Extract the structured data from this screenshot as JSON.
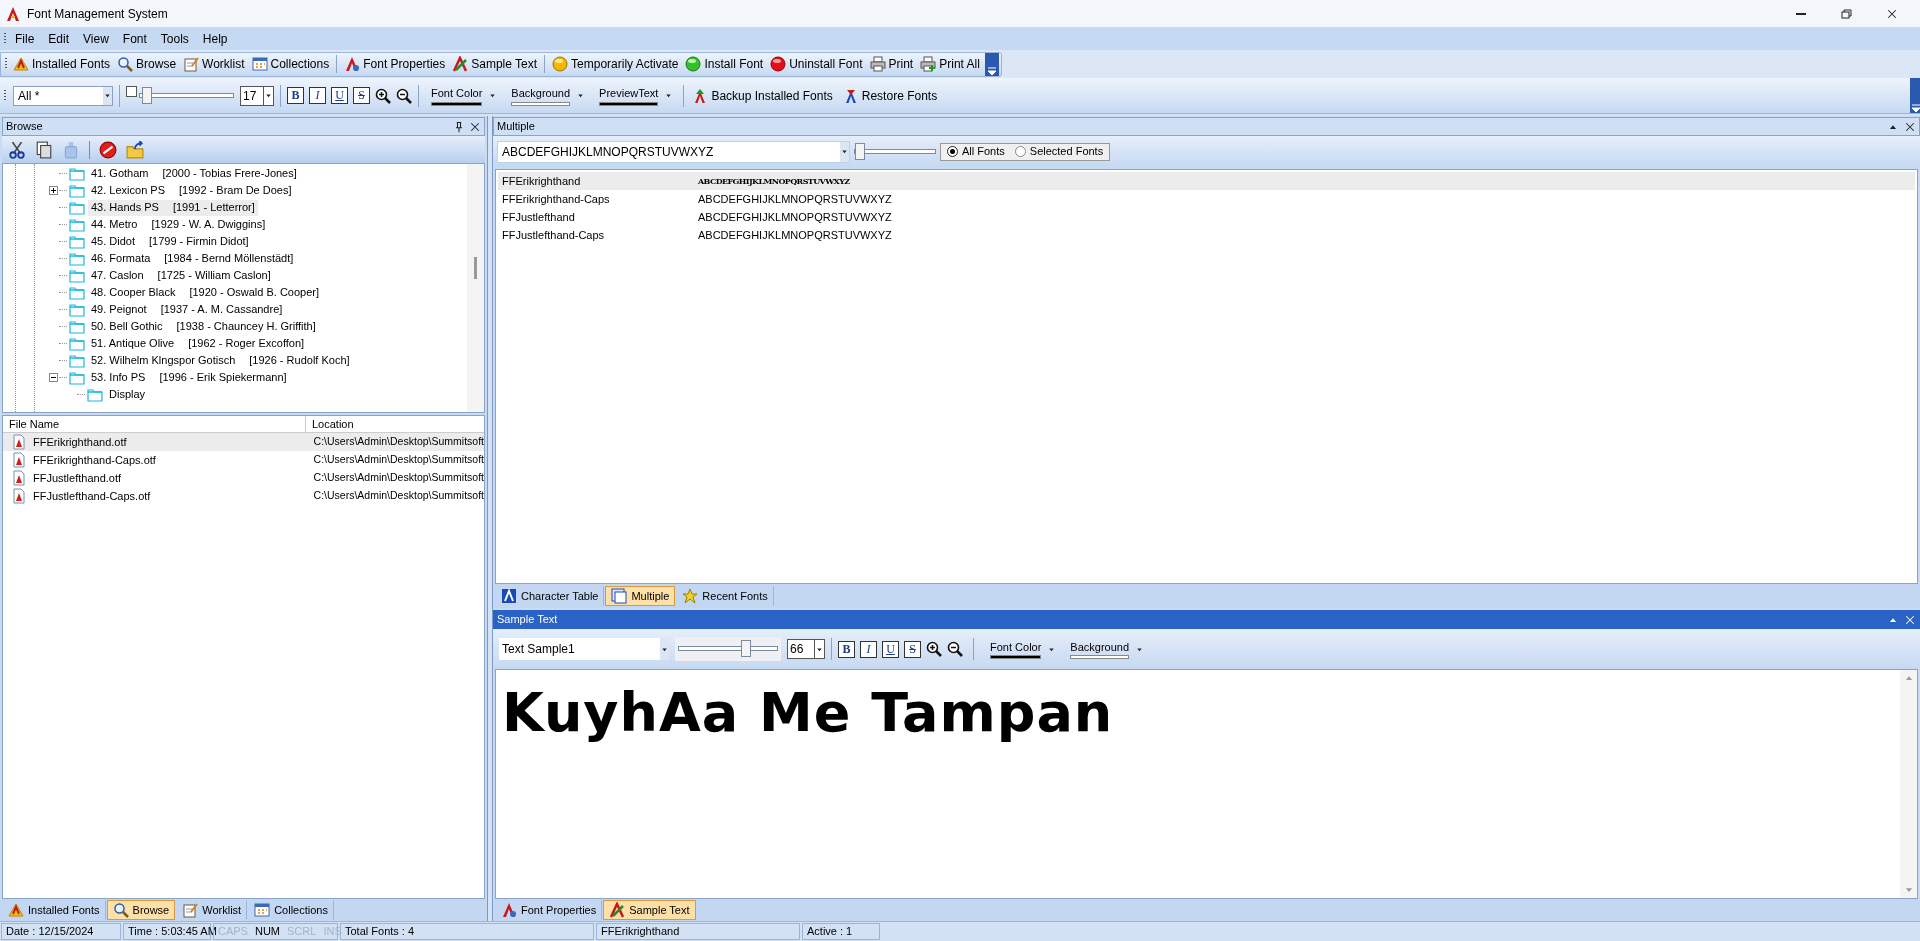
{
  "window": {
    "title": "Font Management System"
  },
  "menu": [
    "File",
    "Edit",
    "View",
    "Font",
    "Tools",
    "Help"
  ],
  "main_toolbar": [
    [
      "Installed Fonts",
      "Browse",
      "Worklist",
      "Collections"
    ],
    [
      "Font Properties",
      "Sample Text"
    ],
    [
      "Temporarily Activate",
      "Install Font",
      "Uninstall Font",
      "Print",
      "Print All"
    ]
  ],
  "format_toolbar": {
    "filter": "All *",
    "slider_checked": false,
    "slider": {
      "level": 0.03
    },
    "size": "17",
    "styles": [
      "B",
      "I",
      "U",
      "S"
    ],
    "color_buttons": [
      {
        "label": "Font Color",
        "color": "#000000"
      },
      {
        "label": "Background",
        "color": "#ffffff"
      },
      {
        "label": "PreviewText",
        "color": "#000000"
      }
    ],
    "actions": [
      "Backup Installed Fonts",
      "Restore Fonts"
    ]
  },
  "browse_panel": {
    "title": "Browse",
    "tree": [
      {
        "label": "41. Gotham",
        "detail": "[2000 - Tobias Frere-Jones]",
        "selected": false
      },
      {
        "label": "42. Lexicon PS",
        "detail": "[1992 - Bram De Does]",
        "selected": false,
        "expanded": false
      },
      {
        "label": "43. Hands PS",
        "detail": "[1991 - Letterror]",
        "selected": true
      },
      {
        "label": "44. Metro",
        "detail": "[1929 - W. A. Dwiggins]",
        "selected": false
      },
      {
        "label": "45. Didot",
        "detail": "[1799 - Firmin Didot]",
        "selected": false
      },
      {
        "label": "46. Formata",
        "detail": "[1984 - Bernd Möllenstädt]",
        "selected": false
      },
      {
        "label": "47. Caslon",
        "detail": "[1725 - William Caslon]",
        "selected": false
      },
      {
        "label": "48. Cooper Black",
        "detail": "[1920 - Oswald B. Cooper]",
        "selected": false
      },
      {
        "label": "49. Peignot",
        "detail": "[1937 - A. M. Cassandre]",
        "selected": false
      },
      {
        "label": "50. Bell Gothic",
        "detail": "[1938 - Chauncey H. Griffith]",
        "selected": false
      },
      {
        "label": "51. Antique Olive",
        "detail": "[1962 - Roger Excoffon]",
        "selected": false
      },
      {
        "label": "52. Wilhelm Klngspor Gotisch",
        "detail": "[1926 - Rudolf Koch]",
        "selected": false
      },
      {
        "label": "53. Info PS",
        "detail": "[1996 - Erik Spiekermann]",
        "selected": false,
        "expanded": true,
        "children": [
          {
            "label": "Display",
            "selected": false
          }
        ]
      }
    ]
  },
  "file_list": {
    "columns": [
      "File Name",
      "Location"
    ],
    "rows": [
      {
        "name": "FFErikrighthand.otf",
        "location": "C:\\Users\\Admin\\Desktop\\Summitsoft",
        "selected": true
      },
      {
        "name": "FFErikrighthand-Caps.otf",
        "location": "C:\\Users\\Admin\\Desktop\\Summitsoft",
        "selected": false
      },
      {
        "name": "FFJustlefthand.otf",
        "location": "C:\\Users\\Admin\\Desktop\\Summitsoft",
        "selected": false
      },
      {
        "name": "FFJustlefthand-Caps.otf",
        "location": "C:\\Users\\Admin\\Desktop\\Summitsoft",
        "selected": false
      }
    ]
  },
  "left_tabs": [
    {
      "label": "Installed Fonts",
      "selected": false
    },
    {
      "label": "Browse",
      "selected": true
    },
    {
      "label": "Worklist",
      "selected": false
    },
    {
      "label": "Collections",
      "selected": false
    }
  ],
  "multiple_panel": {
    "title": "Multiple",
    "preview_text": "ABCDEFGHIJKLMNOPQRSTUVWXYZ",
    "slider": {
      "level": 0.02
    },
    "scope": [
      {
        "label": "All Fonts",
        "selected": true
      },
      {
        "label": "Selected Fonts",
        "selected": false
      }
    ],
    "rows": [
      {
        "name": "FFErikrighthand",
        "sample": "ABCDEFGHIJKLMNOPQRSTUVWXYZ",
        "selected": true,
        "kind": "script"
      },
      {
        "name": "FFErikrighthand-Caps",
        "sample": "ABCDEFGHIJKLMNOPQRSTUVWXYZ",
        "selected": false,
        "kind": "plain"
      },
      {
        "name": "FFJustlefthand",
        "sample": "ABCDEFGHIJKLMNOPQRSTUVWXYZ",
        "selected": false,
        "kind": "plain"
      },
      {
        "name": "FFJustlefthand-Caps",
        "sample": "ABCDEFGHIJKLMNOPQRSTUVWXYZ",
        "selected": false,
        "kind": "plain"
      }
    ]
  },
  "middle_tabs": [
    {
      "label": "Character Table",
      "selected": false
    },
    {
      "label": "Multiple",
      "selected": true
    },
    {
      "label": "Recent Fonts",
      "selected": false
    }
  ],
  "sample_panel": {
    "title": "Sample Text",
    "text_choice": "Text Sample1",
    "slider": {
      "level": 0.7
    },
    "size": "66",
    "styles": [
      "B",
      "I",
      "U",
      "S"
    ],
    "color_buttons": [
      {
        "label": "Font Color",
        "color": "#000000"
      },
      {
        "label": "Background",
        "color": "#ffffff"
      }
    ],
    "preview": "KuyhAa Me Tampan"
  },
  "right_tabs": [
    {
      "label": "Font Properties",
      "selected": false
    },
    {
      "label": "Sample Text",
      "selected": true
    }
  ],
  "status_bar": [
    {
      "text": "Date : 12/15/2024",
      "enabled": true
    },
    {
      "text": "Time : 5:03:45 AM",
      "enabled": true
    },
    {
      "text": "CAPS",
      "enabled": false
    },
    {
      "text": "NUM",
      "enabled": true
    },
    {
      "text": "SCRL",
      "enabled": false
    },
    {
      "text": "INS",
      "enabled": false
    },
    {
      "text": "Total Fonts : 4",
      "enabled": true
    },
    {
      "text": "FFErikrighthand",
      "enabled": true
    },
    {
      "text": "Active : 1",
      "enabled": true
    }
  ]
}
